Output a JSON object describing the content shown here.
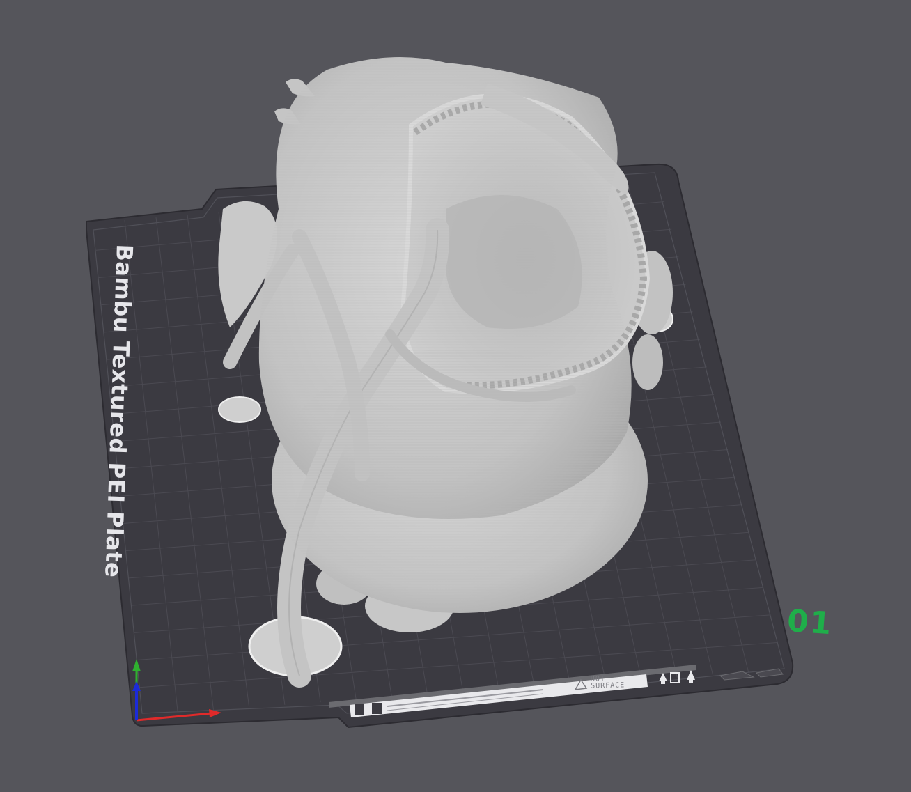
{
  "plate": {
    "label": "Bambu Textured PEI Plate",
    "number": "01",
    "number_color": "#1fae4a"
  },
  "bed_labels": {
    "hot_line1": "HOT",
    "hot_line2": "SURFACE"
  },
  "model": {
    "name": "sliced-creature-model",
    "color": "#c9c9c9"
  },
  "axes": {
    "x_color": "#e02a2a",
    "y_color": "#2fb02f",
    "z_color": "#1c2bd8"
  },
  "colors": {
    "background": "#55555b",
    "plate": "#3b3a41",
    "grid": "#4b4a52"
  }
}
